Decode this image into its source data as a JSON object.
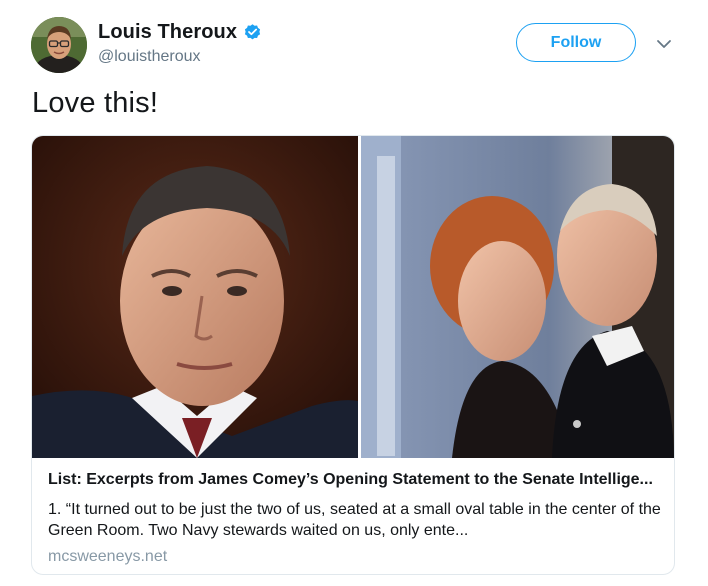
{
  "author": {
    "display_name": "Louis Theroux",
    "handle": "@louistheroux",
    "verified": true,
    "avatar_icon": "profile-photo"
  },
  "actions": {
    "follow_label": "Follow",
    "menu_icon": "chevron-down-icon"
  },
  "tweet": {
    "text": "Love this!"
  },
  "card": {
    "title": "List: Excerpts from James Comey’s Opening Statement to the Senate Intellige...",
    "description": "1. “It turned out to be just the two of us, seated at a small oval table in the center of the Green Room. Two Navy stewards waited on us, only ente...",
    "domain": "mcsweeneys.net"
  },
  "colors": {
    "accent": "#1da1f2",
    "text": "#14171a",
    "secondary_text": "#657786",
    "domain_text": "#8899a6",
    "card_border": "#e1e8ed"
  }
}
